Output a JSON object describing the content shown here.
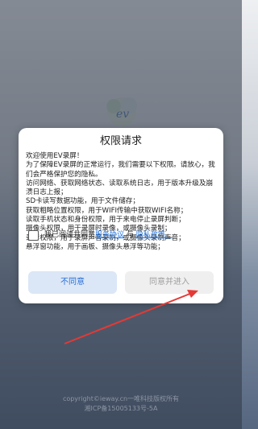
{
  "footer": {
    "line1": "copyright©ieway.cn一唯科技版权所有",
    "line2": "湘ICP备15005133号-5A"
  },
  "dialog": {
    "title": "权限请求",
    "lines": [
      "欢迎使用EV录屏！",
      "为了保障EV录屏的正常运行，我们需要以下权限。请放心，我们会严格保护您的隐私。",
      "访问网络、获取网络状态、读取系统日志，用于版本升级及崩溃日志上报；",
      "SD卡读写数据功能，用于文件储存；",
      "获取粗略位置权限，用于WIFI传输中获取WIFI名称；",
      "读取手机状态和身份权限，用于来电停止录屏判断；",
      "摄像头权限，用于录屏时录像，或摄像头录制；",
      "录音权限，用于录屏声音录制，或摄像头录制声音；",
      "悬浮窗功能，用于画板、摄像头悬浮等功能；"
    ],
    "agree_prefix": "我已阅读并同意",
    "service_link": "服务协议",
    "and_text": " 与 ",
    "privacy_link": "隐私政策。",
    "disagree_label": "不同意",
    "agree_label": "同意并进入"
  },
  "colors": {
    "link": "#1a73e8",
    "disagree_bg": "#dbe7f6",
    "arrow": "#e53935"
  },
  "icons": [
    "ev-logo-icon",
    "arrow-icon"
  ]
}
